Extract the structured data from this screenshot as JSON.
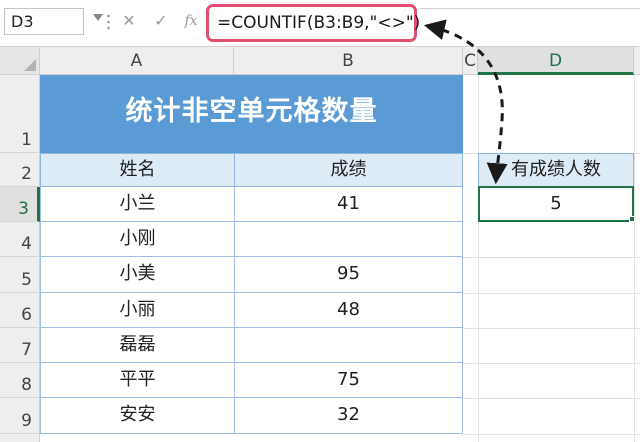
{
  "formula_bar": {
    "name_box": "D3",
    "cancel_symbol": "✕",
    "enter_symbol": "✓",
    "fx_label": "fx",
    "formula": "=COUNTIF(B3:B9,\"<>\")"
  },
  "columns": [
    "A",
    "B",
    "C",
    "D"
  ],
  "rows": [
    "1",
    "2",
    "3",
    "4",
    "5",
    "6",
    "7",
    "8",
    "9"
  ],
  "table": {
    "title": "统计非空单元格数量",
    "headers": [
      "姓名",
      "成绩"
    ],
    "records": [
      {
        "name": "小兰",
        "score": "41"
      },
      {
        "name": "小刚",
        "score": ""
      },
      {
        "name": "小美",
        "score": "95"
      },
      {
        "name": "小丽",
        "score": "48"
      },
      {
        "name": "磊磊",
        "score": ""
      },
      {
        "name": "平平",
        "score": "75"
      },
      {
        "name": "安安",
        "score": "32"
      }
    ]
  },
  "result": {
    "header": "有成绩人数",
    "value": "5"
  },
  "colors": {
    "title_fill": "#5b9bd5",
    "header_fill": "#ddebf7",
    "selection": "#217346",
    "formula_highlight": "#e0506e"
  }
}
